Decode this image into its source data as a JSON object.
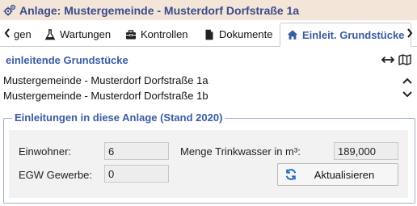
{
  "window": {
    "title": "Anlage: Mustergemeinde - Musterdorf Dorfstraße 1a",
    "title_icon": "gears-icon"
  },
  "tabs": [
    {
      "label": "gen",
      "icon": "",
      "active": false
    },
    {
      "label": "Wartungen",
      "icon": "flask-icon",
      "active": false
    },
    {
      "label": "Kontrollen",
      "icon": "toolbox-icon",
      "active": false
    },
    {
      "label": "Dokumente",
      "icon": "document-icon",
      "active": false
    },
    {
      "label": "Einleit. Grundstücke",
      "icon": "home-icon",
      "active": true
    }
  ],
  "section": {
    "title": "einleitende Grundstücke",
    "items": [
      "Mustergemeinde - Musterdorf Dorfstraße 1a",
      "Mustergemeinde - Musterdorf Dorfstraße 1b"
    ]
  },
  "group": {
    "legend": "Einleitungen in diese Anlage (Stand 2020)",
    "einwohner_label": "Einwohner:",
    "einwohner_value": "6",
    "egw_label": "EGW Gewerbe:",
    "egw_value": "0",
    "trinkwasser_label": "Menge Trinkwasser in m³:",
    "trinkwasser_value": "189,000",
    "refresh_label": "Aktualisieren"
  },
  "colors": {
    "accent": "#3b5ba5",
    "titlebar_bg": "#f3e6d8"
  }
}
